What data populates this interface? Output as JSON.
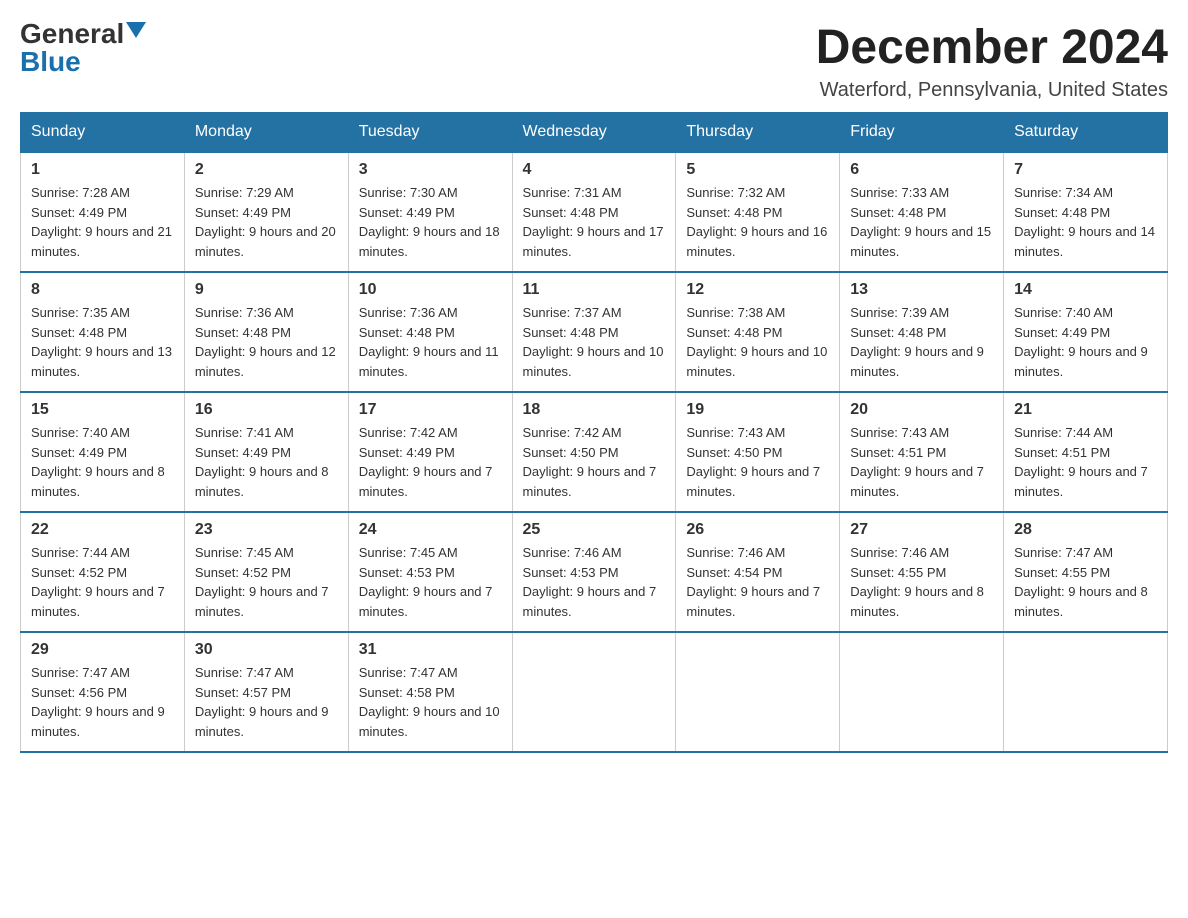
{
  "header": {
    "logo_general": "General",
    "logo_blue": "Blue",
    "month_title": "December 2024",
    "location": "Waterford, Pennsylvania, United States"
  },
  "days_of_week": [
    "Sunday",
    "Monday",
    "Tuesday",
    "Wednesday",
    "Thursday",
    "Friday",
    "Saturday"
  ],
  "weeks": [
    [
      {
        "day": "1",
        "sunrise": "7:28 AM",
        "sunset": "4:49 PM",
        "daylight": "9 hours and 21 minutes."
      },
      {
        "day": "2",
        "sunrise": "7:29 AM",
        "sunset": "4:49 PM",
        "daylight": "9 hours and 20 minutes."
      },
      {
        "day": "3",
        "sunrise": "7:30 AM",
        "sunset": "4:49 PM",
        "daylight": "9 hours and 18 minutes."
      },
      {
        "day": "4",
        "sunrise": "7:31 AM",
        "sunset": "4:48 PM",
        "daylight": "9 hours and 17 minutes."
      },
      {
        "day": "5",
        "sunrise": "7:32 AM",
        "sunset": "4:48 PM",
        "daylight": "9 hours and 16 minutes."
      },
      {
        "day": "6",
        "sunrise": "7:33 AM",
        "sunset": "4:48 PM",
        "daylight": "9 hours and 15 minutes."
      },
      {
        "day": "7",
        "sunrise": "7:34 AM",
        "sunset": "4:48 PM",
        "daylight": "9 hours and 14 minutes."
      }
    ],
    [
      {
        "day": "8",
        "sunrise": "7:35 AM",
        "sunset": "4:48 PM",
        "daylight": "9 hours and 13 minutes."
      },
      {
        "day": "9",
        "sunrise": "7:36 AM",
        "sunset": "4:48 PM",
        "daylight": "9 hours and 12 minutes."
      },
      {
        "day": "10",
        "sunrise": "7:36 AM",
        "sunset": "4:48 PM",
        "daylight": "9 hours and 11 minutes."
      },
      {
        "day": "11",
        "sunrise": "7:37 AM",
        "sunset": "4:48 PM",
        "daylight": "9 hours and 10 minutes."
      },
      {
        "day": "12",
        "sunrise": "7:38 AM",
        "sunset": "4:48 PM",
        "daylight": "9 hours and 10 minutes."
      },
      {
        "day": "13",
        "sunrise": "7:39 AM",
        "sunset": "4:48 PM",
        "daylight": "9 hours and 9 minutes."
      },
      {
        "day": "14",
        "sunrise": "7:40 AM",
        "sunset": "4:49 PM",
        "daylight": "9 hours and 9 minutes."
      }
    ],
    [
      {
        "day": "15",
        "sunrise": "7:40 AM",
        "sunset": "4:49 PM",
        "daylight": "9 hours and 8 minutes."
      },
      {
        "day": "16",
        "sunrise": "7:41 AM",
        "sunset": "4:49 PM",
        "daylight": "9 hours and 8 minutes."
      },
      {
        "day": "17",
        "sunrise": "7:42 AM",
        "sunset": "4:49 PM",
        "daylight": "9 hours and 7 minutes."
      },
      {
        "day": "18",
        "sunrise": "7:42 AM",
        "sunset": "4:50 PM",
        "daylight": "9 hours and 7 minutes."
      },
      {
        "day": "19",
        "sunrise": "7:43 AM",
        "sunset": "4:50 PM",
        "daylight": "9 hours and 7 minutes."
      },
      {
        "day": "20",
        "sunrise": "7:43 AM",
        "sunset": "4:51 PM",
        "daylight": "9 hours and 7 minutes."
      },
      {
        "day": "21",
        "sunrise": "7:44 AM",
        "sunset": "4:51 PM",
        "daylight": "9 hours and 7 minutes."
      }
    ],
    [
      {
        "day": "22",
        "sunrise": "7:44 AM",
        "sunset": "4:52 PM",
        "daylight": "9 hours and 7 minutes."
      },
      {
        "day": "23",
        "sunrise": "7:45 AM",
        "sunset": "4:52 PM",
        "daylight": "9 hours and 7 minutes."
      },
      {
        "day": "24",
        "sunrise": "7:45 AM",
        "sunset": "4:53 PM",
        "daylight": "9 hours and 7 minutes."
      },
      {
        "day": "25",
        "sunrise": "7:46 AM",
        "sunset": "4:53 PM",
        "daylight": "9 hours and 7 minutes."
      },
      {
        "day": "26",
        "sunrise": "7:46 AM",
        "sunset": "4:54 PM",
        "daylight": "9 hours and 7 minutes."
      },
      {
        "day": "27",
        "sunrise": "7:46 AM",
        "sunset": "4:55 PM",
        "daylight": "9 hours and 8 minutes."
      },
      {
        "day": "28",
        "sunrise": "7:47 AM",
        "sunset": "4:55 PM",
        "daylight": "9 hours and 8 minutes."
      }
    ],
    [
      {
        "day": "29",
        "sunrise": "7:47 AM",
        "sunset": "4:56 PM",
        "daylight": "9 hours and 9 minutes."
      },
      {
        "day": "30",
        "sunrise": "7:47 AM",
        "sunset": "4:57 PM",
        "daylight": "9 hours and 9 minutes."
      },
      {
        "day": "31",
        "sunrise": "7:47 AM",
        "sunset": "4:58 PM",
        "daylight": "9 hours and 10 minutes."
      },
      null,
      null,
      null,
      null
    ]
  ]
}
